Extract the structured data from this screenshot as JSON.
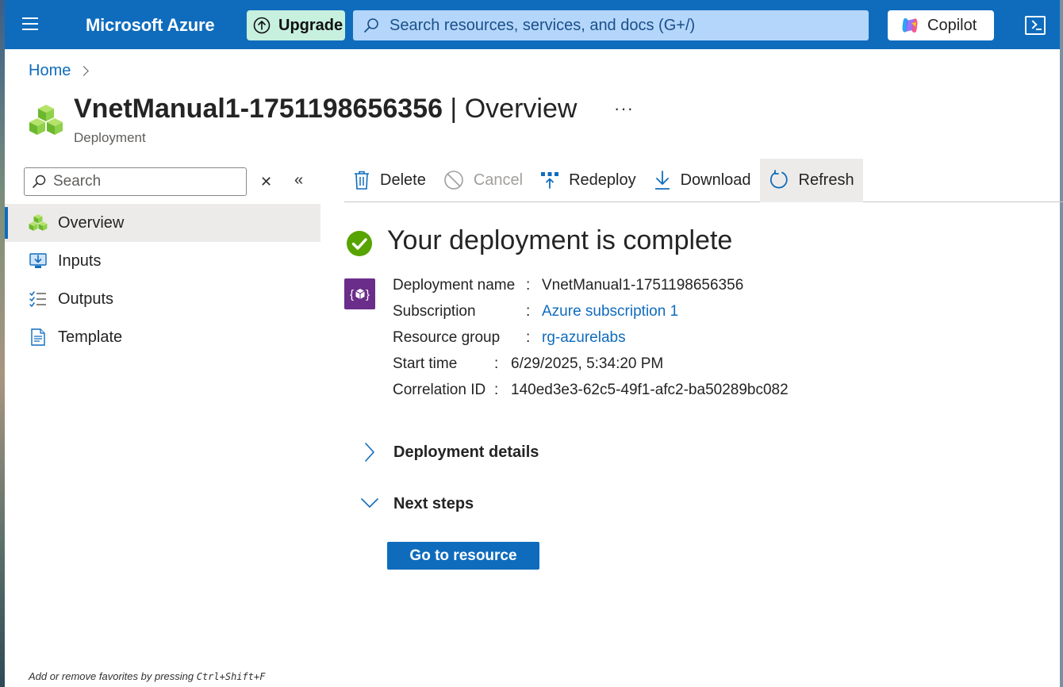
{
  "topbar": {
    "brand": "Microsoft Azure",
    "upgrade_label": "Upgrade",
    "search_placeholder": "Search resources, services, and docs (G+/)",
    "copilot_label": "Copilot",
    "accent_color": "#0f6cbd"
  },
  "breadcrumb": {
    "home": "Home"
  },
  "resource": {
    "name": "VnetManual1-1751198656356",
    "separator": " | ",
    "page": "Overview",
    "type": "Deployment",
    "more_label": "···"
  },
  "sidebar": {
    "search_placeholder": "Search",
    "clear_glyph": "✕",
    "collapse_glyph": "«",
    "items": [
      {
        "label": "Overview",
        "icon": "cubes-icon",
        "active": true
      },
      {
        "label": "Inputs",
        "icon": "inputs-icon",
        "active": false
      },
      {
        "label": "Outputs",
        "icon": "outputs-icon",
        "active": false
      },
      {
        "label": "Template",
        "icon": "template-icon",
        "active": false
      }
    ],
    "footnote_prefix": "Add or remove favorites by pressing ",
    "footnote_kbd": "Ctrl+Shift+F"
  },
  "toolbar": {
    "delete": "Delete",
    "cancel": "Cancel",
    "redeploy": "Redeploy",
    "download": "Download",
    "refresh": "Refresh"
  },
  "main": {
    "status_title": "Your deployment is complete",
    "details": {
      "deployment_name_label": "Deployment name",
      "deployment_name_value": "VnetManual1-1751198656356",
      "subscription_label": "Subscription",
      "subscription_value": "Azure subscription 1",
      "resource_group_label": "Resource group",
      "resource_group_value": "rg-azurelabs",
      "start_time_label": "Start time",
      "start_time_value": "6/29/2025, 5:34:20 PM",
      "correlation_id_label": "Correlation ID",
      "correlation_id_value": "140ed3e3-62c5-49f1-afc2-ba50289bc082"
    },
    "deployment_details": "Deployment details",
    "next_steps": "Next steps",
    "go_to_resource": "Go to resource"
  }
}
